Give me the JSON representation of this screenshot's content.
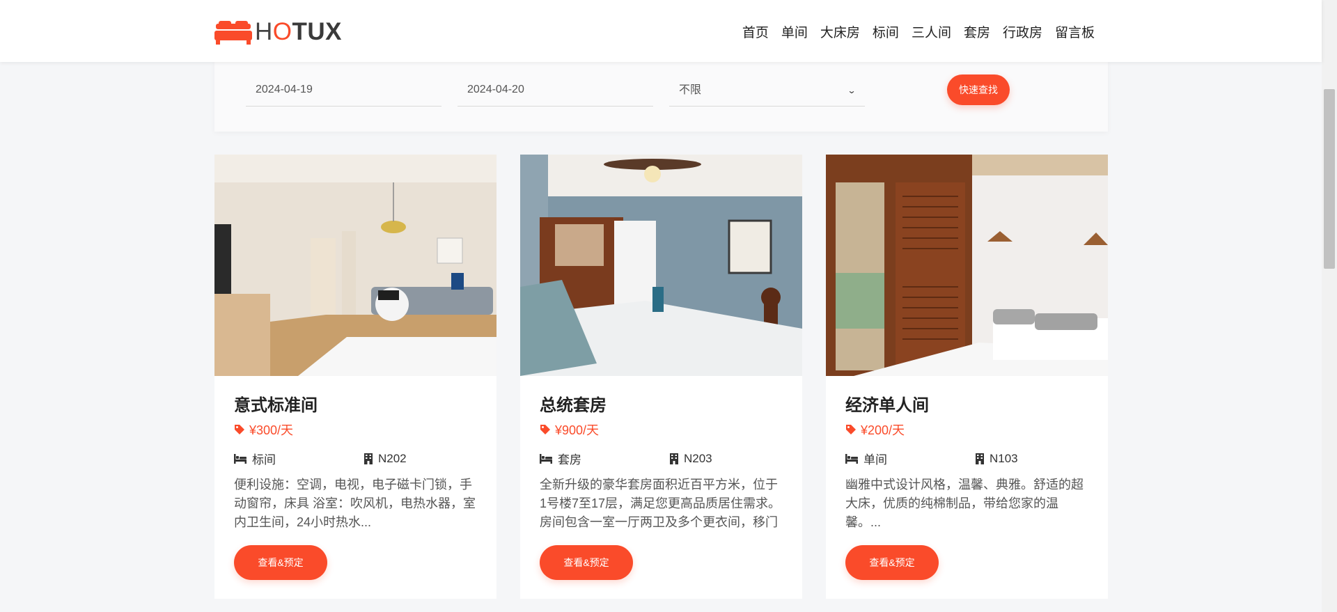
{
  "brand": {
    "logo_h": "H",
    "logo_o": "O",
    "logo_rest": "TUX",
    "accent_color": "#fa4b2a"
  },
  "nav": {
    "items": [
      "首页",
      "单间",
      "大床房",
      "标间",
      "三人间",
      "套房",
      "行政房",
      "留言板"
    ]
  },
  "search": {
    "checkin": "2024-04-19",
    "checkout": "2024-04-20",
    "room_type": "不限",
    "button_label": "快速查找"
  },
  "rooms": [
    {
      "title": "意式标准间",
      "price": "¥300/天",
      "type": "标间",
      "number": "N202",
      "description": "便利设施：空调，电视，电子磁卡门锁，手动窗帘，床具 浴室：吹风机，电热水器，室内卫生间，24小时热水...",
      "button_label": "查看&预定",
      "image_icon": "bedroom-photo"
    },
    {
      "title": "总统套房",
      "price": "¥900/天",
      "type": "套房",
      "number": "N203",
      "description": "全新升级的豪华套房面积近百平方米，位于1号楼7至17层，满足您更高品质居住需求。房间包含一室一厅两卫及多个更衣间，移门",
      "button_label": "查看&预定",
      "image_icon": "bedroom-photo"
    },
    {
      "title": "经济单人间",
      "price": "¥200/天",
      "type": "单间",
      "number": "N103",
      "description": "幽雅中式设计风格，温馨、典雅。舒适的超大床，优质的纯棉制品，带给您家的温馨。...",
      "button_label": "查看&预定",
      "image_icon": "bedroom-photo"
    }
  ]
}
